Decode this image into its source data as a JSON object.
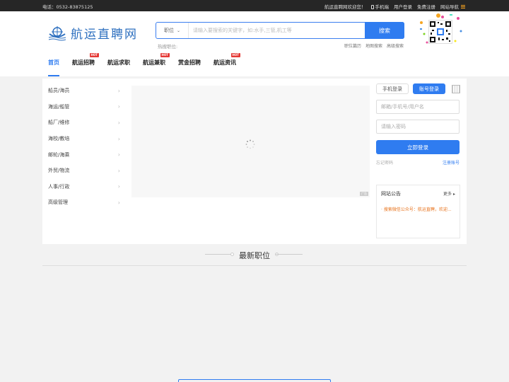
{
  "topbar": {
    "phone": "电话：0532-83875125",
    "welcome": "航运直聘网欢迎您！",
    "mobile": "手机端",
    "user_login": "用户登录",
    "free_register": "免费注册",
    "site_nav": "网站导航"
  },
  "logo": {
    "text": "航运直聘网"
  },
  "search": {
    "type_label": "职位",
    "placeholder": "请输入要搜索的关键字，如:水手,三管,机工等",
    "button": "搜索",
    "hot_label": "热搜职位:",
    "links": [
      "职位篇历",
      "地图搜索",
      "高级搜索"
    ]
  },
  "nav": {
    "items": [
      {
        "label": "首页",
        "hot": false
      },
      {
        "label": "航运招聘",
        "hot": true
      },
      {
        "label": "航运求职",
        "hot": false
      },
      {
        "label": "航运兼职",
        "hot": true
      },
      {
        "label": "赏金招聘",
        "hot": false
      },
      {
        "label": "航运资讯",
        "hot": true
      }
    ],
    "hot_badge": "HOT"
  },
  "categories": [
    "船员/海员",
    "海运/船管",
    "船厂/维修",
    "海校/教培",
    "邮轮/海乘",
    "外贸/物流",
    "人事/行政",
    "高级管理"
  ],
  "banner": {
    "ad_tag": "广告"
  },
  "login": {
    "tab_phone": "手机登录",
    "tab_account": "账号登录",
    "username_placeholder": "邮箱/手机号/用户名",
    "password_placeholder": "请输入密码",
    "submit": "立即登录",
    "forgot": "忘记密码",
    "register": "注册账号"
  },
  "notice": {
    "title": "网站公告",
    "more": "更多",
    "items": [
      "搜索微信公众号：航运直聘，欢迎..."
    ]
  },
  "section": {
    "title": "最新职位"
  },
  "colors": {
    "primary": "#2f7cf0",
    "hot": "#e53935",
    "notice": "#e8731c"
  }
}
